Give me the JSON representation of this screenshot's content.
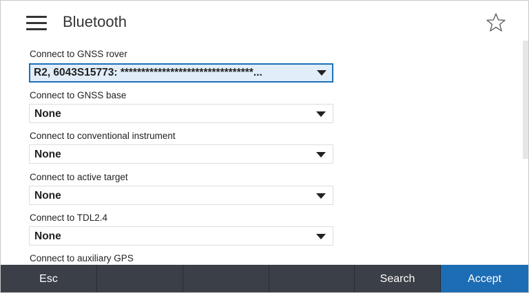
{
  "header": {
    "title": "Bluetooth",
    "menu_icon": "hamburger-menu-icon",
    "favorite_icon": "star-icon"
  },
  "connections": [
    {
      "label": "Connect to GNSS rover",
      "value": "R2, 6043S15773: ********************************..."
    },
    {
      "label": "Connect to GNSS base",
      "value": "None"
    },
    {
      "label": "Connect to conventional instrument",
      "value": "None"
    },
    {
      "label": "Connect to active target",
      "value": "None"
    },
    {
      "label": "Connect to TDL2.4",
      "value": "None"
    },
    {
      "label": "Connect to auxiliary GPS",
      "value": ""
    }
  ],
  "footer": {
    "buttons": [
      "Esc",
      "",
      "",
      "",
      "Search",
      "Accept"
    ]
  },
  "colors": {
    "bottom_bar": "#3b3f47",
    "accept_button": "#1d6db5",
    "selected_field_bg": "#e1eef9",
    "selected_field_border": "#1c6fb8"
  }
}
